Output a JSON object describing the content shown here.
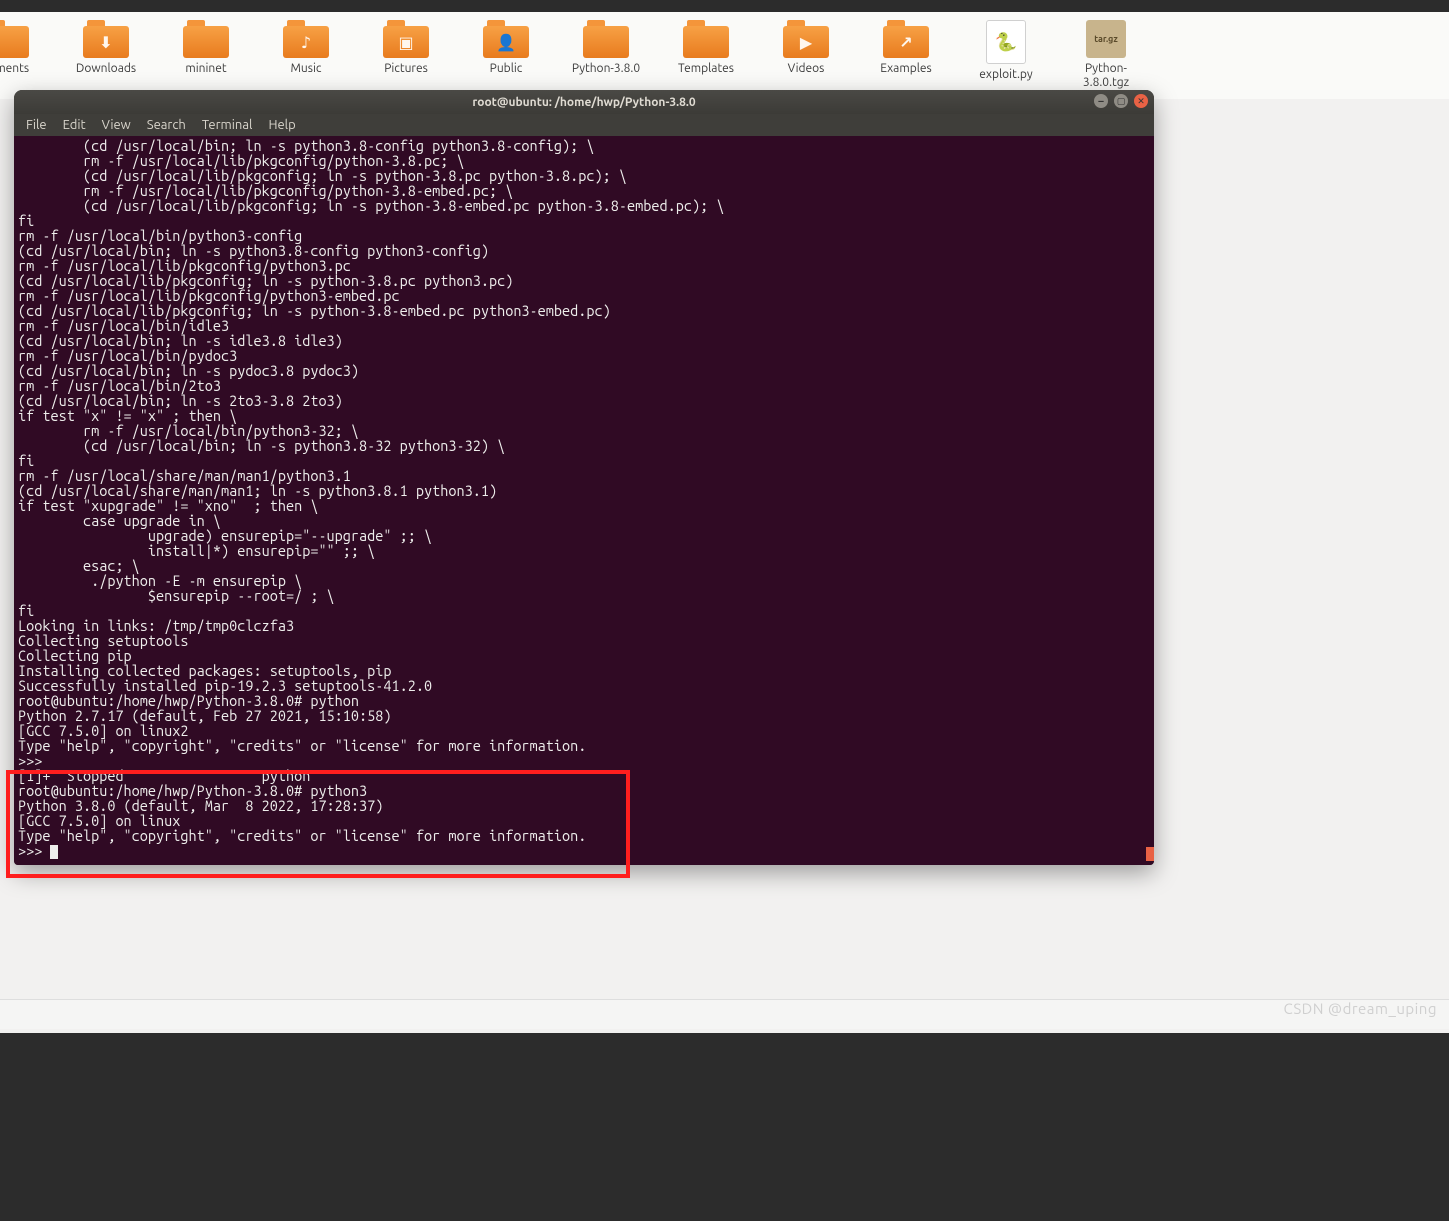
{
  "desktop": {
    "icons": [
      {
        "label": "cuments",
        "glyph": ""
      },
      {
        "label": "Downloads",
        "glyph": "⬇"
      },
      {
        "label": "mininet",
        "glyph": ""
      },
      {
        "label": "Music",
        "glyph": "♪"
      },
      {
        "label": "Pictures",
        "glyph": "▣"
      },
      {
        "label": "Public",
        "glyph": "👤"
      },
      {
        "label": "Python-3.8.0",
        "glyph": ""
      },
      {
        "label": "Templates",
        "glyph": ""
      },
      {
        "label": "Videos",
        "glyph": "▶"
      },
      {
        "label": "Examples",
        "glyph": "↗"
      },
      {
        "label": "exploit.py",
        "type": "file",
        "glyph": "🐍"
      },
      {
        "label": "Python-3.8.0.tgz",
        "type": "archive",
        "glyph": "tar.gz"
      }
    ]
  },
  "terminal": {
    "title": "root@ubuntu: /home/hwp/Python-3.8.0",
    "menu": [
      "File",
      "Edit",
      "View",
      "Search",
      "Terminal",
      "Help"
    ],
    "output": "        (cd /usr/local/bin; ln -s python3.8-config python3.8-config); \\\n        rm -f /usr/local/lib/pkgconfig/python-3.8.pc; \\\n        (cd /usr/local/lib/pkgconfig; ln -s python-3.8.pc python-3.8.pc); \\\n        rm -f /usr/local/lib/pkgconfig/python-3.8-embed.pc; \\\n        (cd /usr/local/lib/pkgconfig; ln -s python-3.8-embed.pc python-3.8-embed.pc); \\\nfi\nrm -f /usr/local/bin/python3-config\n(cd /usr/local/bin; ln -s python3.8-config python3-config)\nrm -f /usr/local/lib/pkgconfig/python3.pc\n(cd /usr/local/lib/pkgconfig; ln -s python-3.8.pc python3.pc)\nrm -f /usr/local/lib/pkgconfig/python3-embed.pc\n(cd /usr/local/lib/pkgconfig; ln -s python-3.8-embed.pc python3-embed.pc)\nrm -f /usr/local/bin/idle3\n(cd /usr/local/bin; ln -s idle3.8 idle3)\nrm -f /usr/local/bin/pydoc3\n(cd /usr/local/bin; ln -s pydoc3.8 pydoc3)\nrm -f /usr/local/bin/2to3\n(cd /usr/local/bin; ln -s 2to3-3.8 2to3)\nif test \"x\" != \"x\" ; then \\\n        rm -f /usr/local/bin/python3-32; \\\n        (cd /usr/local/bin; ln -s python3.8-32 python3-32) \\\nfi\nrm -f /usr/local/share/man/man1/python3.1\n(cd /usr/local/share/man/man1; ln -s python3.8.1 python3.1)\nif test \"xupgrade\" != \"xno\"  ; then \\\n        case upgrade in \\\n                upgrade) ensurepip=\"--upgrade\" ;; \\\n                install|*) ensurepip=\"\" ;; \\\n        esac; \\\n         ./python -E -m ensurepip \\\n                $ensurepip --root=/ ; \\\nfi\nLooking in links: /tmp/tmp0clczfa3\nCollecting setuptools\nCollecting pip\nInstalling collected packages: setuptools, pip\nSuccessfully installed pip-19.2.3 setuptools-41.2.0\nroot@ubuntu:/home/hwp/Python-3.8.0# python\nPython 2.7.17 (default, Feb 27 2021, 15:10:58)\n[GCC 7.5.0] on linux2\nType \"help\", \"copyright\", \"credits\" or \"license\" for more information.\n>>>\n[1]+  Stopped                 python\nroot@ubuntu:/home/hwp/Python-3.8.0# python3\nPython 3.8.0 (default, Mar  8 2022, 17:28:37)\n[GCC 7.5.0] on linux\nType \"help\", \"copyright\", \"credits\" or \"license\" for more information.\n>>> "
  },
  "watermark": "CSDN @dream_uping"
}
